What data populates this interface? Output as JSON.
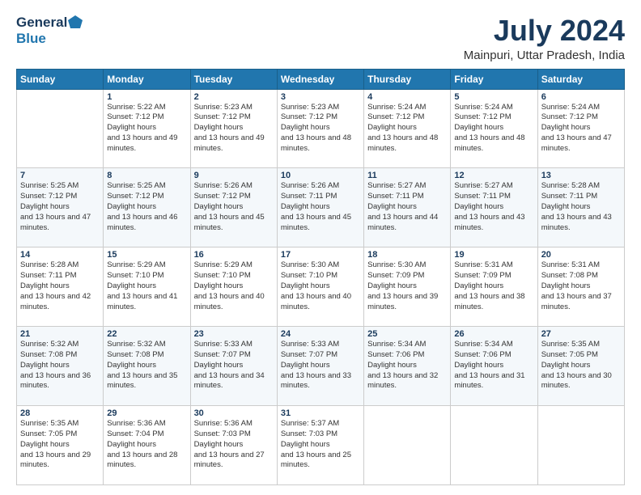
{
  "logo": {
    "general": "General",
    "blue": "Blue"
  },
  "title": {
    "month_year": "July 2024",
    "location": "Mainpuri, Uttar Pradesh, India"
  },
  "headers": [
    "Sunday",
    "Monday",
    "Tuesday",
    "Wednesday",
    "Thursday",
    "Friday",
    "Saturday"
  ],
  "weeks": [
    [
      {
        "day": "",
        "rise": "",
        "set": "",
        "daylight": ""
      },
      {
        "day": "1",
        "rise": "5:22 AM",
        "set": "7:12 PM",
        "hours": "13 hours and 49 minutes."
      },
      {
        "day": "2",
        "rise": "5:23 AM",
        "set": "7:12 PM",
        "hours": "13 hours and 49 minutes."
      },
      {
        "day": "3",
        "rise": "5:23 AM",
        "set": "7:12 PM",
        "hours": "13 hours and 48 minutes."
      },
      {
        "day": "4",
        "rise": "5:24 AM",
        "set": "7:12 PM",
        "hours": "13 hours and 48 minutes."
      },
      {
        "day": "5",
        "rise": "5:24 AM",
        "set": "7:12 PM",
        "hours": "13 hours and 48 minutes."
      },
      {
        "day": "6",
        "rise": "5:24 AM",
        "set": "7:12 PM",
        "hours": "13 hours and 47 minutes."
      }
    ],
    [
      {
        "day": "7",
        "rise": "5:25 AM",
        "set": "7:12 PM",
        "hours": "13 hours and 47 minutes."
      },
      {
        "day": "8",
        "rise": "5:25 AM",
        "set": "7:12 PM",
        "hours": "13 hours and 46 minutes."
      },
      {
        "day": "9",
        "rise": "5:26 AM",
        "set": "7:12 PM",
        "hours": "13 hours and 45 minutes."
      },
      {
        "day": "10",
        "rise": "5:26 AM",
        "set": "7:11 PM",
        "hours": "13 hours and 45 minutes."
      },
      {
        "day": "11",
        "rise": "5:27 AM",
        "set": "7:11 PM",
        "hours": "13 hours and 44 minutes."
      },
      {
        "day": "12",
        "rise": "5:27 AM",
        "set": "7:11 PM",
        "hours": "13 hours and 43 minutes."
      },
      {
        "day": "13",
        "rise": "5:28 AM",
        "set": "7:11 PM",
        "hours": "13 hours and 43 minutes."
      }
    ],
    [
      {
        "day": "14",
        "rise": "5:28 AM",
        "set": "7:11 PM",
        "hours": "13 hours and 42 minutes."
      },
      {
        "day": "15",
        "rise": "5:29 AM",
        "set": "7:10 PM",
        "hours": "13 hours and 41 minutes."
      },
      {
        "day": "16",
        "rise": "5:29 AM",
        "set": "7:10 PM",
        "hours": "13 hours and 40 minutes."
      },
      {
        "day": "17",
        "rise": "5:30 AM",
        "set": "7:10 PM",
        "hours": "13 hours and 40 minutes."
      },
      {
        "day": "18",
        "rise": "5:30 AM",
        "set": "7:09 PM",
        "hours": "13 hours and 39 minutes."
      },
      {
        "day": "19",
        "rise": "5:31 AM",
        "set": "7:09 PM",
        "hours": "13 hours and 38 minutes."
      },
      {
        "day": "20",
        "rise": "5:31 AM",
        "set": "7:08 PM",
        "hours": "13 hours and 37 minutes."
      }
    ],
    [
      {
        "day": "21",
        "rise": "5:32 AM",
        "set": "7:08 PM",
        "hours": "13 hours and 36 minutes."
      },
      {
        "day": "22",
        "rise": "5:32 AM",
        "set": "7:08 PM",
        "hours": "13 hours and 35 minutes."
      },
      {
        "day": "23",
        "rise": "5:33 AM",
        "set": "7:07 PM",
        "hours": "13 hours and 34 minutes."
      },
      {
        "day": "24",
        "rise": "5:33 AM",
        "set": "7:07 PM",
        "hours": "13 hours and 33 minutes."
      },
      {
        "day": "25",
        "rise": "5:34 AM",
        "set": "7:06 PM",
        "hours": "13 hours and 32 minutes."
      },
      {
        "day": "26",
        "rise": "5:34 AM",
        "set": "7:06 PM",
        "hours": "13 hours and 31 minutes."
      },
      {
        "day": "27",
        "rise": "5:35 AM",
        "set": "7:05 PM",
        "hours": "13 hours and 30 minutes."
      }
    ],
    [
      {
        "day": "28",
        "rise": "5:35 AM",
        "set": "7:05 PM",
        "hours": "13 hours and 29 minutes."
      },
      {
        "day": "29",
        "rise": "5:36 AM",
        "set": "7:04 PM",
        "hours": "13 hours and 28 minutes."
      },
      {
        "day": "30",
        "rise": "5:36 AM",
        "set": "7:03 PM",
        "hours": "13 hours and 27 minutes."
      },
      {
        "day": "31",
        "rise": "5:37 AM",
        "set": "7:03 PM",
        "hours": "13 hours and 25 minutes."
      },
      {
        "day": "",
        "rise": "",
        "set": "",
        "hours": ""
      },
      {
        "day": "",
        "rise": "",
        "set": "",
        "hours": ""
      },
      {
        "day": "",
        "rise": "",
        "set": "",
        "hours": ""
      }
    ]
  ]
}
